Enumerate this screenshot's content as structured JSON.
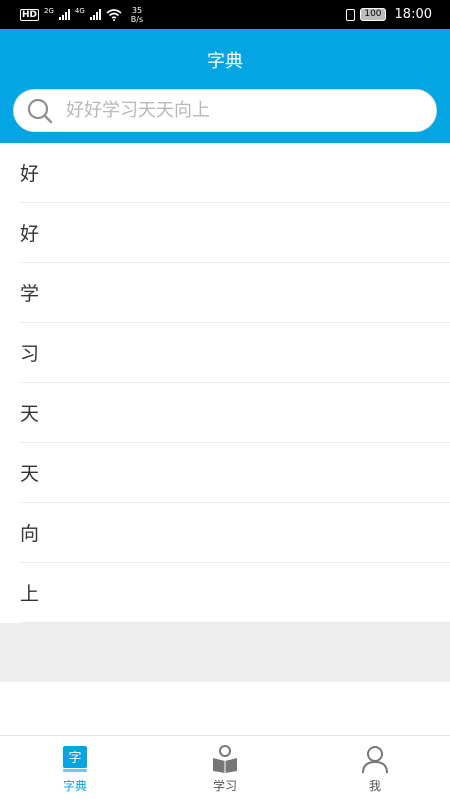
{
  "status_bar": {
    "hd": "HD",
    "net1": "2G",
    "net2": "4G",
    "speed_value": "35",
    "speed_unit": "B/s",
    "battery": "100",
    "time": "18:00"
  },
  "header": {
    "title": "字典",
    "search_placeholder": "好好学习天天向上"
  },
  "characters": [
    "好",
    "好",
    "学",
    "习",
    "天",
    "天",
    "向",
    "上"
  ],
  "nav": {
    "active": "dictionary",
    "items": [
      {
        "id": "dictionary",
        "label": "字典",
        "icon": "dictionary-icon",
        "icon_char": "字"
      },
      {
        "id": "study",
        "label": "学习",
        "icon": "study-icon"
      },
      {
        "id": "me",
        "label": "我",
        "icon": "person-icon"
      }
    ]
  },
  "colors": {
    "accent": "#03a6e2",
    "inactive_icon": "#777777"
  }
}
